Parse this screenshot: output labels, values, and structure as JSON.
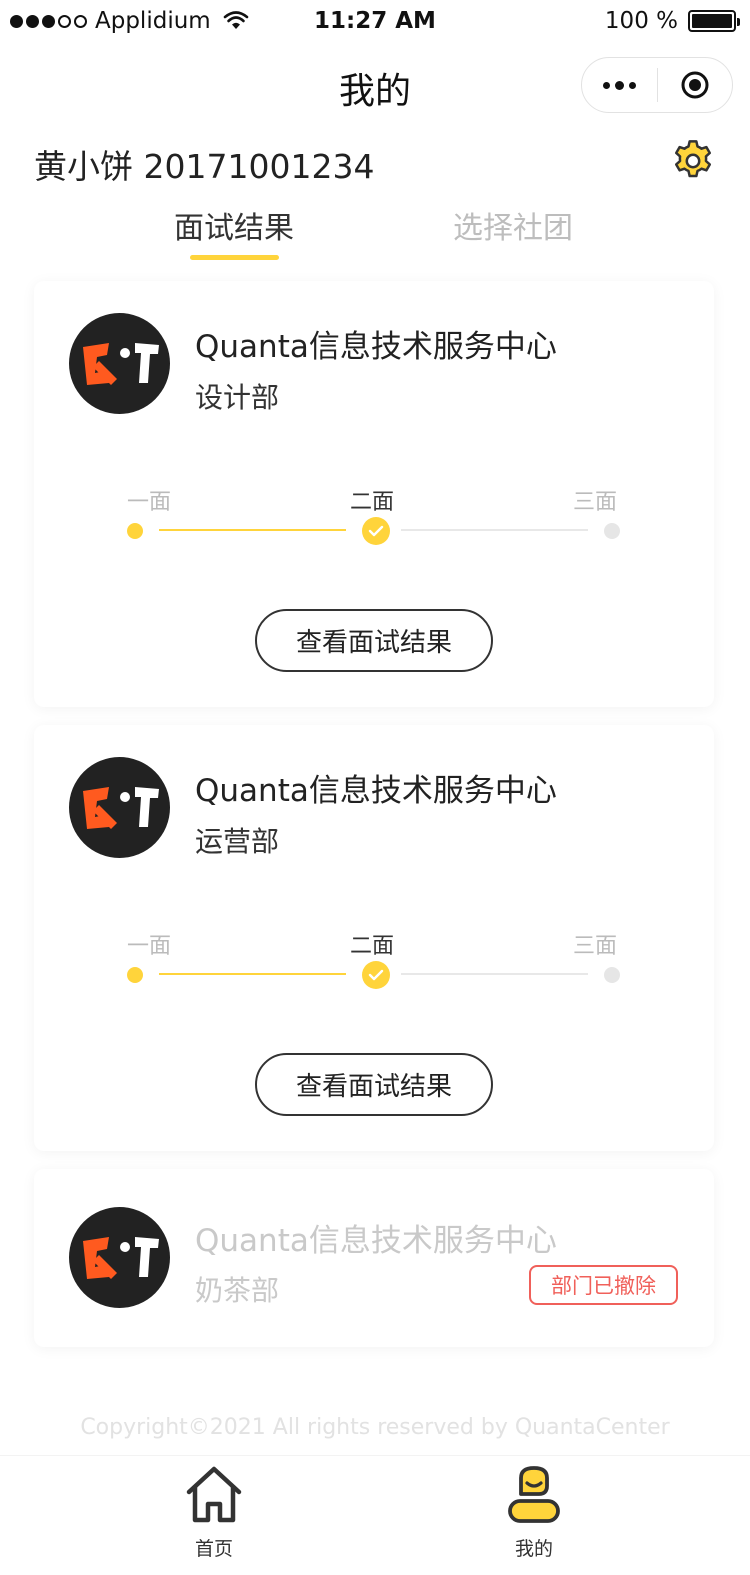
{
  "status_bar": {
    "carrier": "Applidium",
    "time": "11:27 AM",
    "battery": "100 %"
  },
  "nav": {
    "title": "我的"
  },
  "user": {
    "line": "黄小饼 20171001234"
  },
  "tabs": [
    {
      "label": "面试结果",
      "active": true
    },
    {
      "label": "选择社团",
      "active": false
    }
  ],
  "cards": [
    {
      "org": "Quanta信息技术服务中心",
      "dept": "设计部",
      "steps": [
        "一面",
        "二面",
        "三面"
      ],
      "current_step": 2,
      "button": "查看面试结果"
    },
    {
      "org": "Quanta信息技术服务中心",
      "dept": "运营部",
      "steps": [
        "一面",
        "二面",
        "三面"
      ],
      "current_step": 2,
      "button": "查看面试结果"
    },
    {
      "org": "Quanta信息技术服务中心",
      "dept": "奶茶部",
      "badge": "部门已撤除",
      "disabled": true
    }
  ],
  "footer": {
    "copyright": "Copyright©2021 All rights reserved by QuantaCenter"
  },
  "tabbar": [
    {
      "label": "首页",
      "icon": "home-icon"
    },
    {
      "label": "我的",
      "icon": "profile-icon"
    }
  ],
  "colors": {
    "accent": "#ffd43b",
    "danger": "#f0605a",
    "logo_orange": "#ff5a1f"
  }
}
